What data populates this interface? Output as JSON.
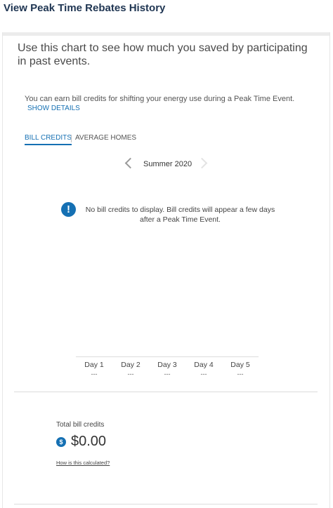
{
  "header": {
    "title": "View Peak Time Rebates History"
  },
  "intro": {
    "text": "Use this chart to see how much you saved by participating in past events."
  },
  "info": {
    "text": "You can earn bill credits for shifting your energy use during a Peak Time Event.",
    "show_details": "SHOW DETAILS"
  },
  "tabs": [
    {
      "label": "BILL CREDITS",
      "active": true
    },
    {
      "label": "AVERAGE HOMES",
      "active": false
    }
  ],
  "season": {
    "label": "Summer 2020",
    "prev_icon": "chevron-left-icon",
    "next_icon": "chevron-right-icon"
  },
  "alert": {
    "icon": "info-icon",
    "text": "No bill credits to display. Bill credits will appear a few days after a Peak Time Event."
  },
  "days": [
    {
      "label": "Day 1",
      "value": "---"
    },
    {
      "label": "Day 2",
      "value": "---"
    },
    {
      "label": "Day 3",
      "value": "---"
    },
    {
      "label": "Day 4",
      "value": "---"
    },
    {
      "label": "Day 5",
      "value": "---"
    }
  ],
  "total": {
    "label": "Total bill credits",
    "icon": "dollar-icon",
    "value": "$0.00",
    "how_link": "How is this calculated?"
  },
  "colors": {
    "accent": "#1570b3",
    "title": "#1f3552"
  }
}
